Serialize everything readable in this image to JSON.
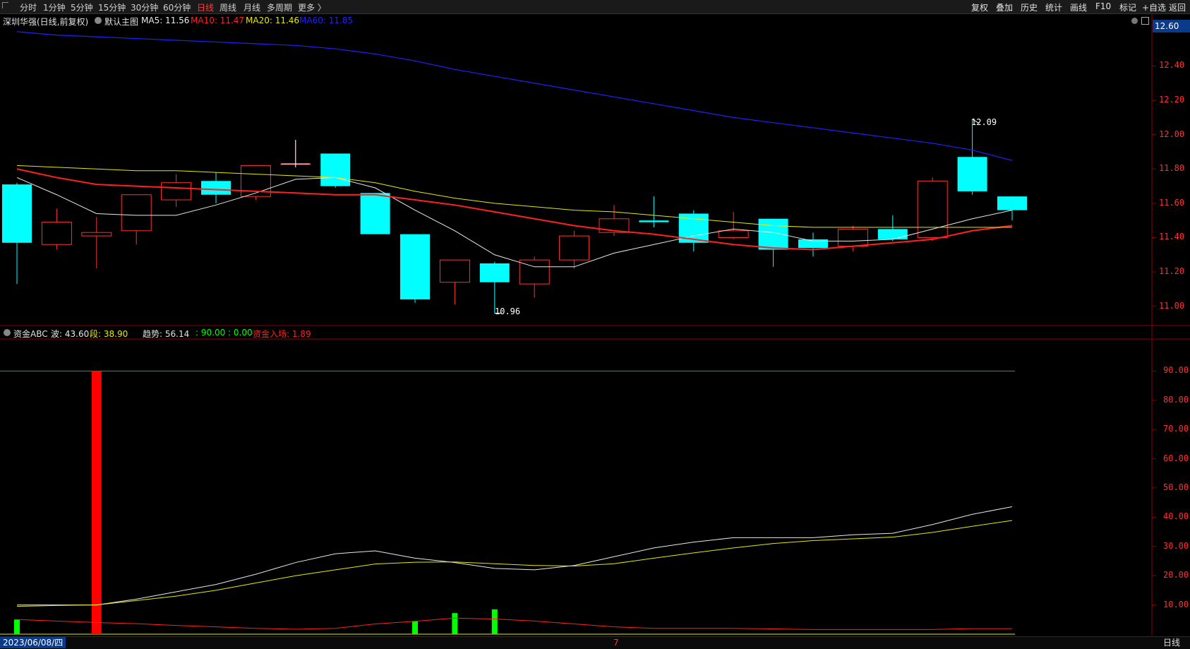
{
  "tabs": [
    "分时",
    "1分钟",
    "5分钟",
    "15分钟",
    "30分钟",
    "60分钟",
    "日线",
    "周线",
    "月线",
    "多周期",
    "更多 〉"
  ],
  "active_tab": "日线",
  "right_buttons": [
    "复权",
    "叠加",
    "历史",
    "统计",
    "画线",
    "F10",
    "标记",
    "+自选",
    "返回"
  ],
  "main_info": {
    "stock": "深圳华强(日线,前复权)",
    "template": "默认主图",
    "ma5": "MA5: 11.56",
    "ma10": "MA10: 11.47",
    "ma20": "MA20: 11.46",
    "ma60": "MA60: 11.85"
  },
  "current_price": "12.60",
  "price_axis": [
    "12.40",
    "12.20",
    "12.00",
    "11.80",
    "11.60",
    "11.40",
    "11.20",
    "11.00"
  ],
  "annotations": {
    "high": "12.09",
    "low": "10.96"
  },
  "sub_info": {
    "name": "资金ABC",
    "wave": "波: 43.60",
    "seg": "段: 38.90",
    "trend": "趋势: 56.14",
    "extra": ": 90.00 : 0.00",
    "inflow": "资金入场: 1.89"
  },
  "sub_axis": [
    "90.00",
    "80.00",
    "70.00",
    "60.00",
    "50.00",
    "40.00",
    "30.00",
    "20.00",
    "10.00"
  ],
  "bottom": {
    "date": "2023/06/08/四",
    "month_mark": "7",
    "period": "日线"
  },
  "colors": {
    "up": "#ff3030",
    "down": "#00ffff",
    "ma5": "#e8e8e8",
    "ma10": "#ff2020",
    "ma20": "#e8e800",
    "ma60": "#2020ff",
    "axis": "#8b0000"
  },
  "chart_data": [
    {
      "type": "candlestick",
      "title": "深圳华强(日线,前复权)",
      "ylim": [
        10.9,
        12.62
      ],
      "candles": [
        {
          "o": 11.71,
          "h": 11.72,
          "l": 11.13,
          "c": 11.37
        },
        {
          "o": 11.36,
          "h": 11.57,
          "l": 11.33,
          "c": 11.49
        },
        {
          "o": 11.41,
          "h": 11.52,
          "l": 11.22,
          "c": 11.43
        },
        {
          "o": 11.44,
          "h": 11.65,
          "l": 11.36,
          "c": 11.65
        },
        {
          "o": 11.62,
          "h": 11.77,
          "l": 11.58,
          "c": 11.72
        },
        {
          "o": 11.73,
          "h": 11.78,
          "l": 11.6,
          "c": 11.65
        },
        {
          "o": 11.64,
          "h": 11.82,
          "l": 11.62,
          "c": 11.82
        },
        {
          "o": 11.83,
          "h": 11.97,
          "l": 11.81,
          "c": 11.83
        },
        {
          "o": 11.89,
          "h": 11.89,
          "l": 11.69,
          "c": 11.7
        },
        {
          "o": 11.66,
          "h": 11.66,
          "l": 11.42,
          "c": 11.42
        },
        {
          "o": 11.42,
          "h": 11.42,
          "l": 11.02,
          "c": 11.04
        },
        {
          "o": 11.14,
          "h": 11.27,
          "l": 11.01,
          "c": 11.27
        },
        {
          "o": 11.25,
          "h": 11.26,
          "l": 10.96,
          "c": 11.14
        },
        {
          "o": 11.13,
          "h": 11.29,
          "l": 11.05,
          "c": 11.27
        },
        {
          "o": 11.27,
          "h": 11.44,
          "l": 11.22,
          "c": 11.41
        },
        {
          "o": 11.43,
          "h": 11.59,
          "l": 11.41,
          "c": 11.51
        },
        {
          "o": 11.5,
          "h": 11.64,
          "l": 11.46,
          "c": 11.49
        },
        {
          "o": 11.54,
          "h": 11.56,
          "l": 11.32,
          "c": 11.37
        },
        {
          "o": 11.4,
          "h": 11.55,
          "l": 11.39,
          "c": 11.44
        },
        {
          "o": 11.51,
          "h": 11.51,
          "l": 11.23,
          "c": 11.33
        },
        {
          "o": 11.39,
          "h": 11.43,
          "l": 11.29,
          "c": 11.34
        },
        {
          "o": 11.35,
          "h": 11.47,
          "l": 11.32,
          "c": 11.45
        },
        {
          "o": 11.45,
          "h": 11.53,
          "l": 11.38,
          "c": 11.39
        },
        {
          "o": 11.4,
          "h": 11.75,
          "l": 11.38,
          "c": 11.73
        },
        {
          "o": 11.87,
          "h": 12.09,
          "l": 11.65,
          "c": 11.67
        },
        {
          "o": 11.64,
          "h": 11.64,
          "l": 11.5,
          "c": 11.56
        }
      ],
      "series": [
        {
          "name": "MA5",
          "values": [
            11.75,
            11.65,
            11.54,
            11.53,
            11.53,
            11.59,
            11.66,
            11.74,
            11.75,
            11.69,
            11.56,
            11.44,
            11.3,
            11.23,
            11.23,
            11.31,
            11.36,
            11.41,
            11.45,
            11.43,
            11.38,
            11.38,
            11.39,
            11.45,
            11.51,
            11.56
          ]
        },
        {
          "name": "MA10",
          "values": [
            11.8,
            11.75,
            11.71,
            11.7,
            11.69,
            11.68,
            11.67,
            11.66,
            11.65,
            11.65,
            11.62,
            11.59,
            11.55,
            11.51,
            11.47,
            11.44,
            11.42,
            11.39,
            11.36,
            11.34,
            11.33,
            11.35,
            11.37,
            11.39,
            11.44,
            11.47
          ]
        },
        {
          "name": "MA20",
          "values": [
            11.82,
            11.81,
            11.8,
            11.79,
            11.79,
            11.78,
            11.77,
            11.76,
            11.75,
            11.72,
            11.67,
            11.63,
            11.6,
            11.58,
            11.56,
            11.55,
            11.53,
            11.51,
            11.49,
            11.47,
            11.46,
            11.46,
            11.46,
            11.46,
            11.46,
            11.46
          ]
        },
        {
          "name": "MA60",
          "values": [
            12.6,
            12.58,
            12.57,
            12.56,
            12.55,
            12.54,
            12.53,
            12.52,
            12.5,
            12.47,
            12.43,
            12.38,
            12.34,
            12.3,
            12.26,
            12.22,
            12.18,
            12.14,
            12.1,
            12.07,
            12.04,
            12.01,
            11.98,
            11.95,
            11.91,
            11.85
          ]
        }
      ]
    },
    {
      "type": "line",
      "title": "资金ABC",
      "ylim": [
        0,
        100
      ],
      "series": [
        {
          "name": "波",
          "values": [
            10,
            10,
            10,
            12,
            14.5,
            17,
            20.5,
            24.5,
            27.5,
            28.5,
            26,
            24.5,
            22.5,
            22,
            23.5,
            26.5,
            29.5,
            31.5,
            33,
            33,
            33,
            34,
            34.5,
            37.5,
            41,
            43.6
          ]
        },
        {
          "name": "段",
          "values": [
            9.5,
            9.8,
            10,
            11.5,
            13,
            15,
            17.5,
            20,
            22,
            24,
            24.6,
            24.7,
            24.1,
            23.5,
            23.3,
            24.1,
            26,
            27.8,
            29.5,
            31,
            32,
            32.6,
            33.2,
            34.8,
            36.9,
            38.9
          ]
        },
        {
          "name": "资金入场",
          "values": [
            5,
            4.5,
            4,
            3.6,
            3,
            2.5,
            2,
            1.7,
            2,
            3.5,
            4.4,
            5.5,
            5.2,
            4.5,
            3.5,
            2.5,
            2,
            2,
            2,
            1.8,
            1.6,
            1.6,
            1.6,
            1.6,
            1.9,
            1.89
          ]
        }
      ],
      "bars": [
        {
          "index": 0,
          "value": 5,
          "color": "#00ff00"
        },
        {
          "index": 2,
          "value": 90,
          "color": "#ff0000"
        },
        {
          "index": 10,
          "value": 4.5,
          "color": "#00ff00"
        },
        {
          "index": 11,
          "value": 7.2,
          "color": "#00ff00"
        },
        {
          "index": 12,
          "value": 8.5,
          "color": "#00ff00"
        }
      ],
      "reference_lines": [
        90,
        0
      ]
    }
  ]
}
